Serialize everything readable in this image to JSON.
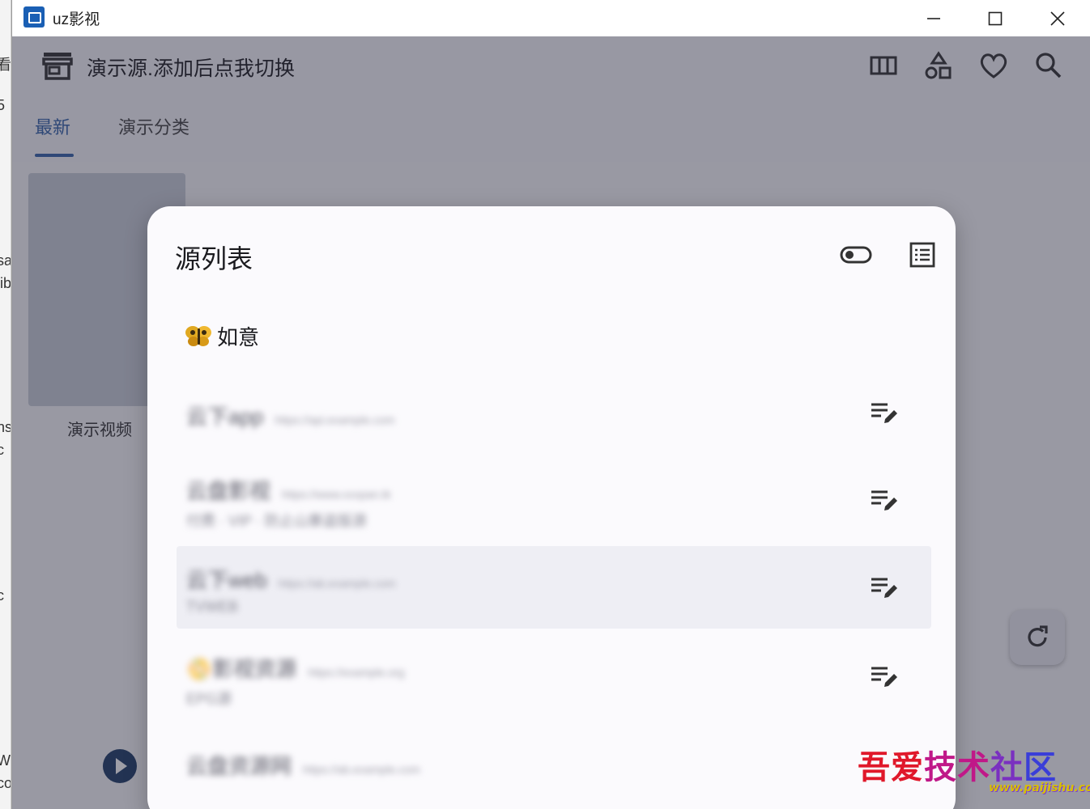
{
  "desktop_strip": [
    "看",
    "5",
    "sa",
    "lib",
    "ns",
    "c",
    "c",
    "W",
    "co"
  ],
  "window": {
    "title": "uz影视",
    "controls": [
      "minimize-icon",
      "maximize-icon",
      "close-icon"
    ]
  },
  "appbar": {
    "source_title": "演示源.添加后点我切换",
    "icons": [
      "columns-icon",
      "category-icon",
      "heart-icon",
      "search-icon"
    ]
  },
  "tabs": [
    {
      "label": "最新",
      "active": true
    },
    {
      "label": "演示分类",
      "active": false
    }
  ],
  "content": {
    "poster_label": "演示视频"
  },
  "dialog": {
    "title": "源列表",
    "header_icons": [
      "toggle-icon",
      "list-view-icon"
    ],
    "group": {
      "emoji": "butterfly-emoji",
      "label": "如意"
    },
    "sources": [
      {
        "name": "云下app",
        "url": "https://api.example.com",
        "sub": "",
        "highlighted": false
      },
      {
        "name": "云盘影视",
        "url": "https://www.xxxpan.tk",
        "sub": "付费 · VIP · 防止山寨盗版源",
        "highlighted": false
      },
      {
        "name": "云下web",
        "url": "https://ab.example.com",
        "sub": "TVWEB",
        "highlighted": true
      },
      {
        "name": "📀影视资源",
        "url": "https://example.org",
        "sub": "EPG源",
        "highlighted": false
      },
      {
        "name": "云盘资源网",
        "url": "https://ab.example.com",
        "sub": "",
        "highlighted": false
      }
    ]
  },
  "watermark": {
    "text": "吾爱技术社区",
    "url": "www.paijishu.com"
  }
}
